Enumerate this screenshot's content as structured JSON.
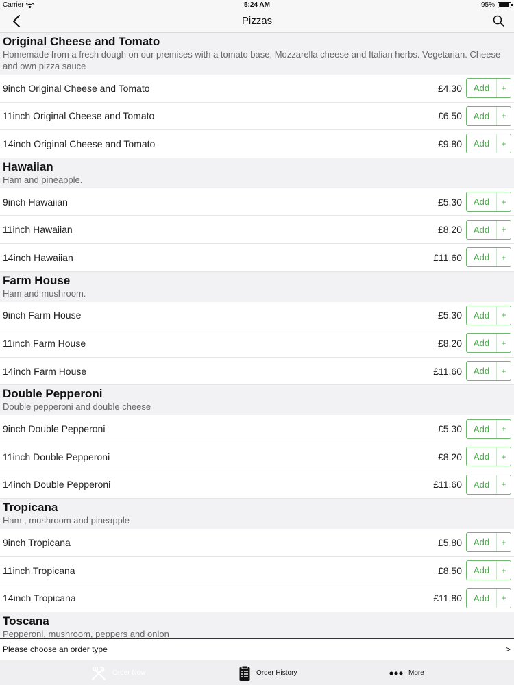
{
  "status_bar": {
    "carrier": "Carrier",
    "time": "5:24 AM",
    "battery_percent": "95%",
    "battery_level": 0.95
  },
  "nav": {
    "title": "Pizzas"
  },
  "sections": [
    {
      "title": "Original Cheese and Tomato",
      "desc": "Homemade from a fresh dough on our premises with a tomato base, Mozzarella cheese and Italian herbs. Vegetarian. Cheese and own pizza sauce",
      "items": [
        {
          "name": "9inch Original Cheese and Tomato",
          "price": "£4.30"
        },
        {
          "name": "11inch Original Cheese and Tomato",
          "price": "£6.50"
        },
        {
          "name": "14inch Original Cheese and Tomato",
          "price": "£9.80"
        }
      ]
    },
    {
      "title": "Hawaiian",
      "desc": "Ham and pineapple.",
      "items": [
        {
          "name": "9inch Hawaiian",
          "price": "£5.30"
        },
        {
          "name": "11inch Hawaiian",
          "price": "£8.20"
        },
        {
          "name": "14inch Hawaiian",
          "price": "£11.60"
        }
      ]
    },
    {
      "title": "Farm House",
      "desc": "Ham and mushroom.",
      "items": [
        {
          "name": "9inch Farm House",
          "price": "£5.30"
        },
        {
          "name": "11inch Farm House",
          "price": "£8.20"
        },
        {
          "name": "14inch Farm House",
          "price": "£11.60"
        }
      ]
    },
    {
      "title": "Double Pepperoni",
      "desc": "Double pepperoni and double cheese",
      "items": [
        {
          "name": "9inch Double Pepperoni",
          "price": "£5.30"
        },
        {
          "name": "11inch Double Pepperoni",
          "price": "£8.20"
        },
        {
          "name": "14inch Double Pepperoni",
          "price": "£11.60"
        }
      ]
    },
    {
      "title": "Tropicana",
      "desc": "Ham , mushroom and pineapple",
      "items": [
        {
          "name": "9inch Tropicana",
          "price": "£5.80"
        },
        {
          "name": "11inch Tropicana",
          "price": "£8.50"
        },
        {
          "name": "14inch Tropicana",
          "price": "£11.80"
        }
      ]
    },
    {
      "title": "Toscana",
      "desc": "Pepperoni, mushroom, peppers and onion",
      "items": []
    }
  ],
  "buttons": {
    "add_label": "Add",
    "plus_label": "+"
  },
  "order_type": {
    "text": "Please choose an order type",
    "arrow": ">"
  },
  "tabs": [
    {
      "label": "Order Now",
      "icon": "fork-knife-icon"
    },
    {
      "label": "Order History",
      "icon": "clipboard-icon"
    },
    {
      "label": "More",
      "icon": "more-dots-icon"
    }
  ],
  "colors": {
    "accent_green": "#4aa84a",
    "section_bg": "#f2f2f4",
    "tab_bar_bg": "#efeff1"
  }
}
